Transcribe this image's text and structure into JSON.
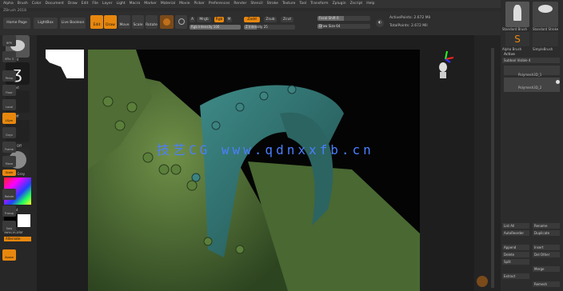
{
  "app": {
    "title_version": "ZBrush 2018",
    "menus": [
      "Alpha",
      "Brush",
      "Color",
      "Document",
      "Draw",
      "Edit",
      "File",
      "Layer",
      "Light",
      "Macro",
      "Marker",
      "Material",
      "Movie",
      "Picker",
      "Preferences",
      "Render",
      "Stencil",
      "Stroke",
      "Texture",
      "Tool",
      "Transform",
      "Zplugin",
      "Zscript",
      "Help"
    ]
  },
  "topbar": {
    "home_page": "Home Page",
    "lightbox": "LightBox",
    "live_boolean": "Live Boolean",
    "edit": "Edit",
    "draw": "Draw",
    "move": "Move",
    "scale": "Scale",
    "rotate": "Rotate",
    "a": "A",
    "mrgb": "Mrgb",
    "rgb": "Rgb",
    "m": "M",
    "zadd": "Zadd",
    "zsub": "Zsub",
    "zcut": "Zcut",
    "focal_shift": "Focal Shift 0",
    "draw_size": "Draw Size 64",
    "rgb_intensity": "Rgb Intensity 100",
    "z_intensity": "Z Intensity 25",
    "dynamic": "Dynamic",
    "active_points": "ActivePoints: 2.672 Mil",
    "total_points": "TotalPoints: 2.672 Mil"
  },
  "left": {
    "brush": "Standard",
    "stroke": "Freehand",
    "alpha": "Alpha Off",
    "texture": "Texture Off",
    "material": "MatCap Gray",
    "gradient": "Gradient",
    "switch_color": "SwitchColor",
    "alternate": "Alternate"
  },
  "watermark": "技艺CG www.qdnxxfb.cn",
  "right_shelf": [
    "BPR",
    "SPix 3",
    "Persp",
    "Floor",
    "Local",
    "LSym",
    "Gxyz",
    "Frame",
    "Move",
    "Scale",
    "Rotate",
    "Transp",
    "Solo",
    "Xpose"
  ],
  "tray": {
    "subtools": [
      "Standard Brush",
      "Standard Stroke",
      "Alpha Brush",
      "SimpleBrush"
    ],
    "append": "Append",
    "active": "Active",
    "subtool_visible": "Subtool Visible 4",
    "items": [
      "Polymesh3D_1",
      "Polymesh3D_2"
    ],
    "bottom": [
      "List All",
      "Rename",
      "AutoReorder",
      "Duplicate",
      "Append",
      "Insert",
      "Delete",
      "Del Other",
      "Split",
      "Merge",
      "Extract",
      "Remesh"
    ]
  },
  "colors": {
    "accent": "#e8870e",
    "model": "#5a7a3a",
    "shield": "#2f6b6a"
  }
}
